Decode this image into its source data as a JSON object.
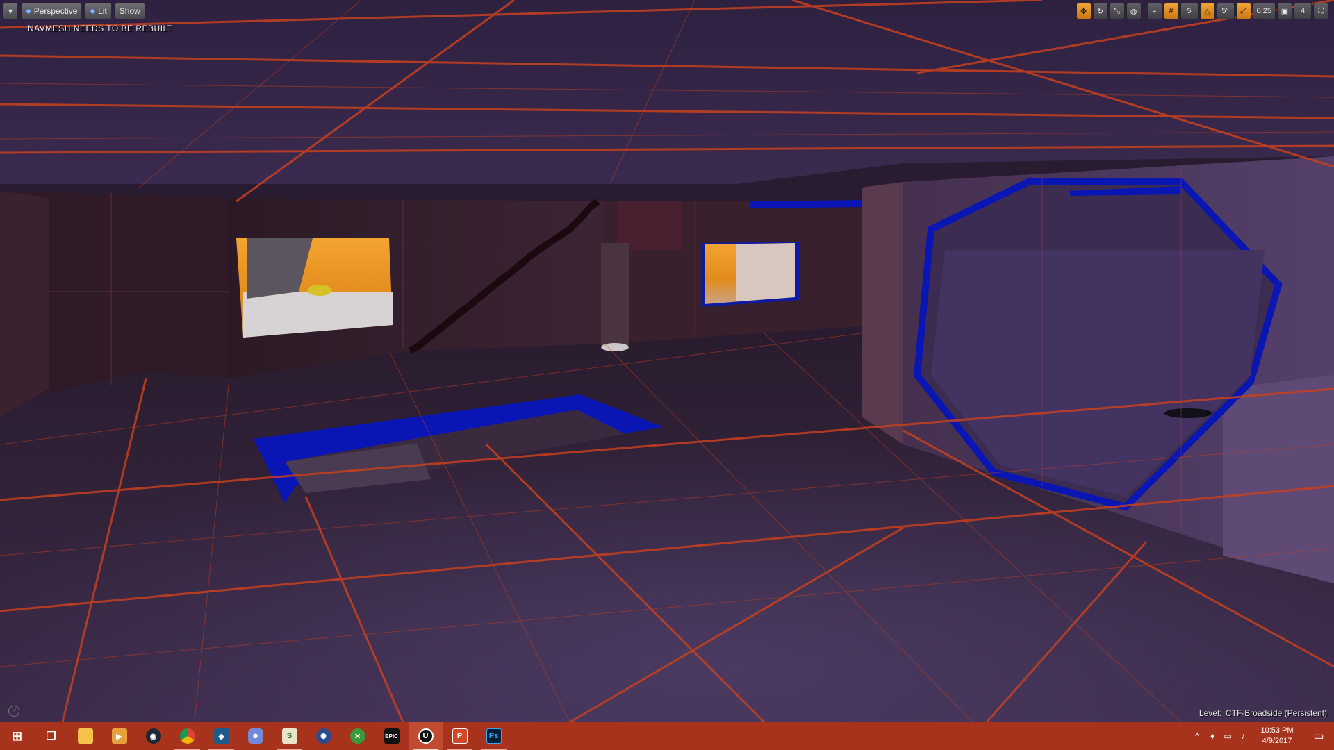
{
  "viewport": {
    "dropdown_label": "▾",
    "perspective_label": "Perspective",
    "lit_label": "Lit",
    "show_label": "Show",
    "navmesh_warning": "NAVMESH NEEDS TO BE REBUILT",
    "grid_snap": "5",
    "rotation_snap": "5°",
    "scale_snap": "0.25",
    "camera_speed": "4",
    "level_label": "Level:",
    "level_name": "CTF-Broadside (Persistent)",
    "help_glyph": "?"
  },
  "taskbar": {
    "apps": [
      {
        "name": "start",
        "glyph": "⊞"
      },
      {
        "name": "task-view",
        "glyph": "❐"
      },
      {
        "name": "file-explorer",
        "glyph": ""
      },
      {
        "name": "media-player",
        "glyph": "▶"
      },
      {
        "name": "steam",
        "glyph": "◉"
      },
      {
        "name": "chrome",
        "glyph": ""
      },
      {
        "name": "app-blue",
        "glyph": "◆"
      },
      {
        "name": "discord",
        "glyph": "☻"
      },
      {
        "name": "app-s",
        "glyph": "S"
      },
      {
        "name": "app-round",
        "glyph": "✺"
      },
      {
        "name": "app-green",
        "glyph": "✕"
      },
      {
        "name": "epic",
        "glyph": "EPIC"
      },
      {
        "name": "unreal",
        "glyph": "U"
      },
      {
        "name": "powerpoint",
        "glyph": "P"
      },
      {
        "name": "photoshop",
        "glyph": "Ps"
      }
    ],
    "time": "10:53 PM",
    "date": "4/9/2017"
  },
  "colors": {
    "taskbar": "#a8331c",
    "grid_line": "#c8401e",
    "wall": "#3a2438",
    "blue_trim": "#0a16b4",
    "orange_room": "#f09a26"
  }
}
